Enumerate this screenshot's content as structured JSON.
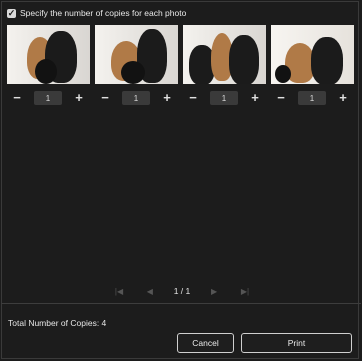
{
  "header": {
    "checkbox_label": "Specify the number of copies for each photo",
    "checkbox_checked": true
  },
  "photos": [
    {
      "copies": "1",
      "minus_label": "−",
      "plus_label": "+"
    },
    {
      "copies": "1",
      "minus_label": "−",
      "plus_label": "+"
    },
    {
      "copies": "1",
      "minus_label": "−",
      "plus_label": "+"
    },
    {
      "copies": "1",
      "minus_label": "−",
      "plus_label": "+"
    }
  ],
  "pager": {
    "first_icon": "first-page-icon",
    "prev_icon": "previous-page-icon",
    "next_icon": "next-page-icon",
    "last_icon": "last-page-icon",
    "page_text": "1 / 1"
  },
  "footer": {
    "total_label": "Total Number of Copies: 4",
    "cancel_label": "Cancel",
    "print_label": "Print"
  },
  "colors": {
    "background": "#1c1c1c",
    "qty_box": "#3a3a3a",
    "button_border": "#cfcfcf"
  }
}
